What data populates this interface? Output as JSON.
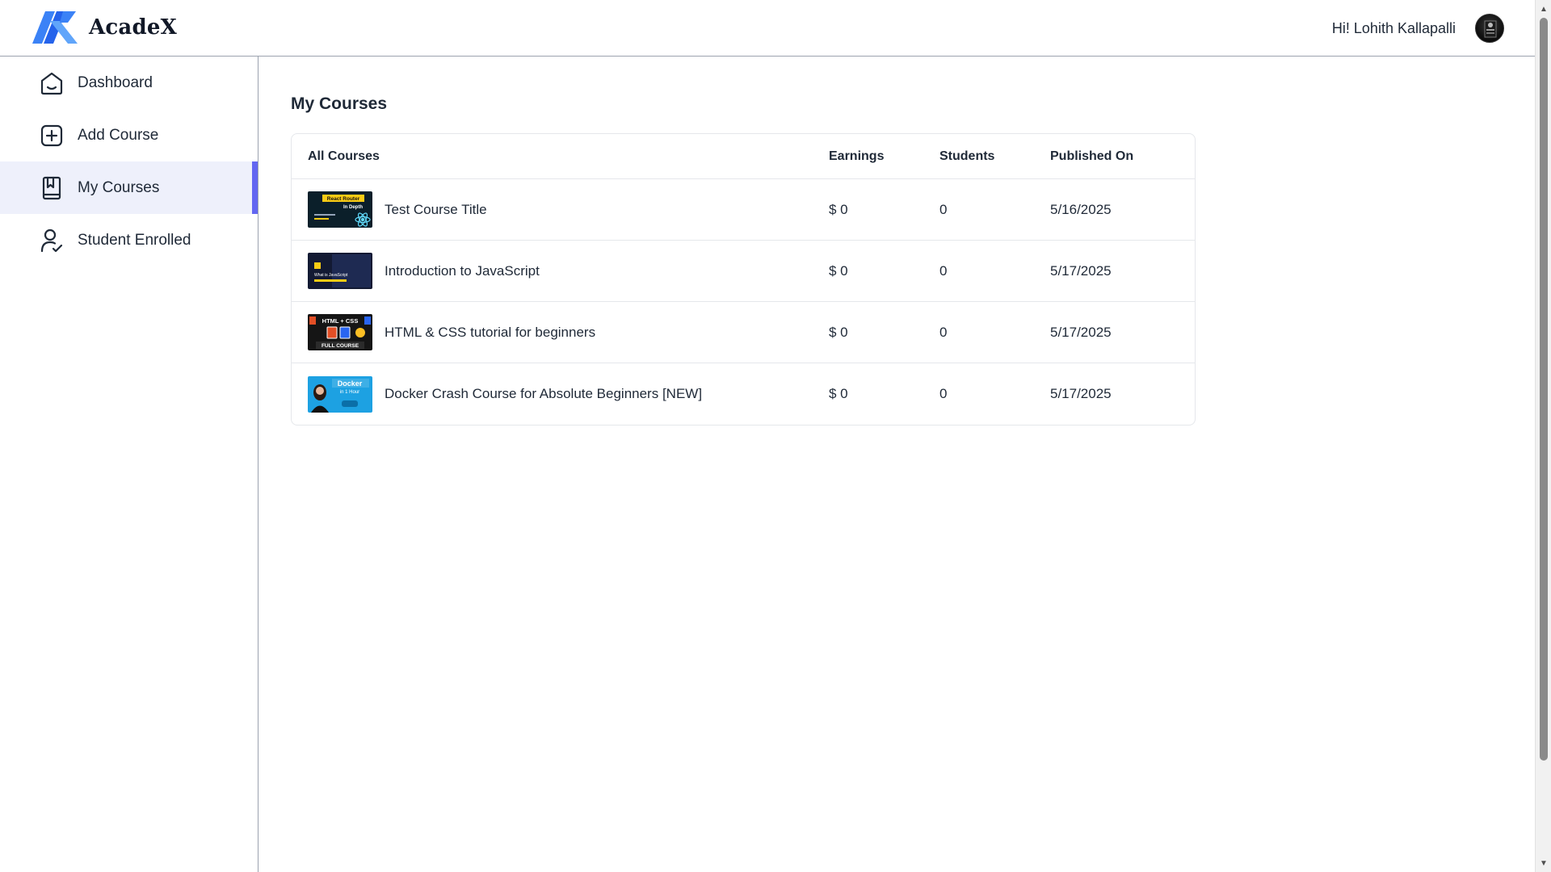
{
  "app": {
    "name": "AcadeX",
    "logo_icon": "acadex-logo-icon"
  },
  "header": {
    "greeting": "Hi! Lohith Kallapalli",
    "avatar_icon": "user-avatar"
  },
  "sidebar": {
    "accent_color": "#6366f1",
    "active_bg": "#eef0fb",
    "items": [
      {
        "label": "Dashboard",
        "icon": "home-icon",
        "active": false
      },
      {
        "label": "Add Course",
        "icon": "add-square-icon",
        "active": false
      },
      {
        "label": "My Courses",
        "icon": "book-bookmark-icon",
        "active": true
      },
      {
        "label": "Student Enrolled",
        "icon": "user-check-icon",
        "active": false
      }
    ]
  },
  "main": {
    "title": "My Courses",
    "table": {
      "headers": [
        "All Courses",
        "Earnings",
        "Students",
        "Published On"
      ],
      "rows": [
        {
          "thumbnail_text": [
            "React Router",
            "In Depth"
          ],
          "title": "Test Course Title",
          "earnings": "$ 0",
          "students": "0",
          "published": "5/16/2025"
        },
        {
          "thumbnail_text": [
            "What is JavaScript"
          ],
          "title": "Introduction to JavaScript",
          "earnings": "$ 0",
          "students": "0",
          "published": "5/17/2025"
        },
        {
          "thumbnail_text": [
            "HTML + CSS",
            "FULL COURSE"
          ],
          "title": "HTML & CSS tutorial for beginners",
          "earnings": "$ 0",
          "students": "0",
          "published": "5/17/2025"
        },
        {
          "thumbnail_text": [
            "Docker",
            "in 1 Hour"
          ],
          "title": "Docker Crash Course for Absolute Beginners [NEW]",
          "earnings": "$ 0",
          "students": "0",
          "published": "5/17/2025"
        }
      ]
    }
  }
}
